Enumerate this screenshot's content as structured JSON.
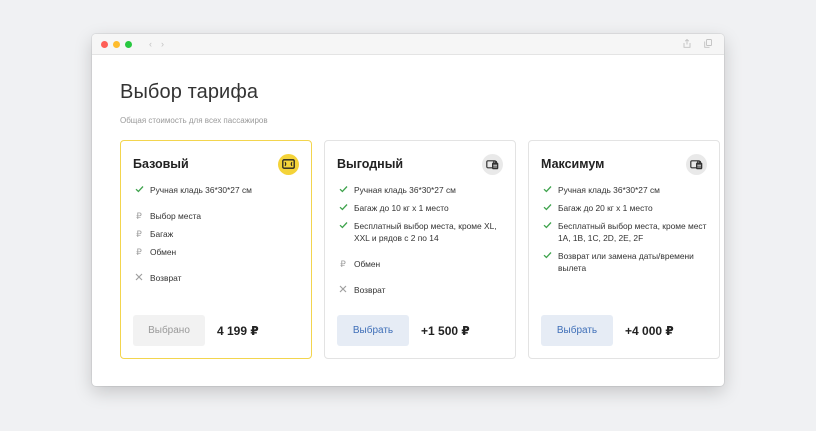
{
  "window": {
    "nav_back": "‹",
    "nav_forward": "›",
    "share_icon": "share-icon",
    "copy_icon": "copy-icon"
  },
  "page": {
    "title": "Выбор тарифа",
    "subtitle": "Общая стоимость для всех пассажиров"
  },
  "tariffs": [
    {
      "name": "Базовый",
      "icon": "ticket-icon",
      "selected": true,
      "features": [
        {
          "status": "included",
          "text": "Ручная кладь 36*30*27 см"
        },
        {
          "status": "paid",
          "text": "Выбор места"
        },
        {
          "status": "paid",
          "text": "Багаж"
        },
        {
          "status": "paid",
          "text": "Обмен"
        },
        {
          "status": "excluded",
          "text": "Возврат"
        }
      ],
      "button_label": "Выбрано",
      "price": "4 199 ₽"
    },
    {
      "name": "Выгодный",
      "icon": "luggage-ticket-icon",
      "selected": false,
      "features": [
        {
          "status": "included",
          "text": "Ручная кладь 36*30*27 см"
        },
        {
          "status": "included",
          "text": "Багаж до 10 кг x 1 место"
        },
        {
          "status": "included",
          "text": "Бесплатный выбор места, кроме XL, XXL и рядов с 2 по 14"
        },
        {
          "status": "paid",
          "text": "Обмен"
        },
        {
          "status": "excluded",
          "text": "Возврат"
        }
      ],
      "button_label": "Выбрать",
      "price": "+1 500 ₽"
    },
    {
      "name": "Максимум",
      "icon": "luggage-ticket-icon",
      "selected": false,
      "features": [
        {
          "status": "included",
          "text": "Ручная кладь 36*30*27 см"
        },
        {
          "status": "included",
          "text": "Багаж до 20 кг x 1 место"
        },
        {
          "status": "included",
          "text": "Бесплатный выбор места, кроме мест 1A, 1B, 1C, 2D, 2E, 2F"
        },
        {
          "status": "included",
          "text": "Возврат или замена даты/времени вылета"
        }
      ],
      "button_label": "Выбрать",
      "price": "+4 000 ₽"
    }
  ],
  "colors": {
    "selected_border": "#f3d54e",
    "check": "#3fa34d",
    "button_primary_bg": "#e6ecf5",
    "button_primary_text": "#3f6fb8"
  }
}
